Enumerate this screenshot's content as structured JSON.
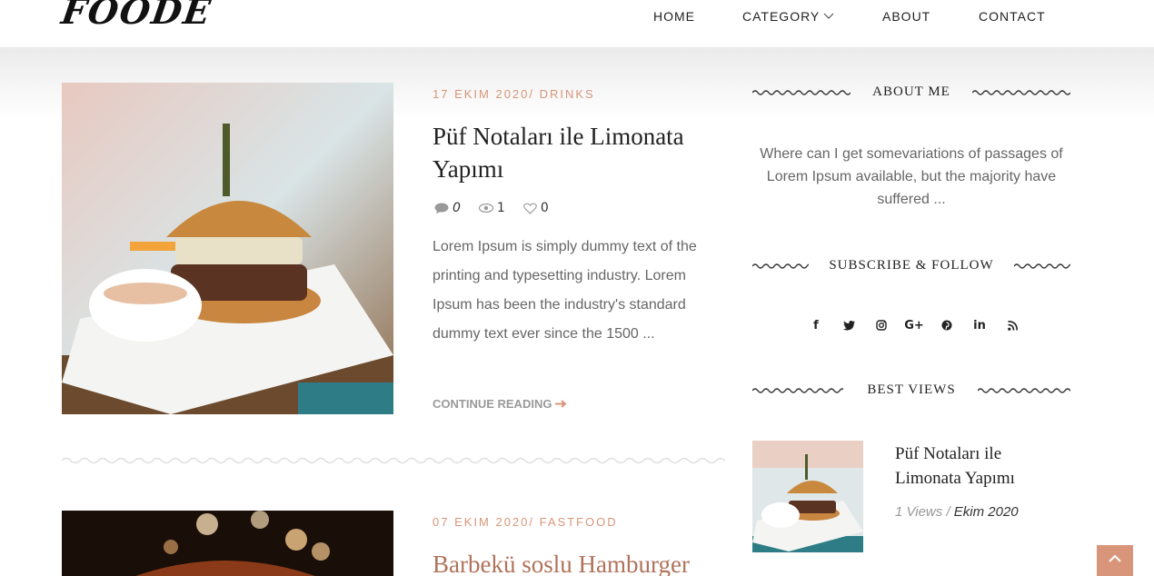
{
  "header": {
    "logo": "FOODE",
    "nav": {
      "home": "HOME",
      "category": "CATEGORY",
      "about": "ABOUT",
      "contact": "CONTACT"
    }
  },
  "posts": [
    {
      "meta": "17 EKIM 2020/ DRINKS",
      "title": "Püf Notaları ile Limonata Yapımı",
      "comments": "0",
      "views": "1",
      "likes": "0",
      "excerpt": "Lorem Ipsum is simply dummy text of the printing and typesetting industry. Lorem Ipsum has been the industry's standard dummy text ever since the 1500 ...",
      "continue": "CONTINUE READING"
    },
    {
      "meta": "07 EKIM 2020/ FASTFOOD",
      "title": "Barbekü soslu Hamburger"
    }
  ],
  "sidebar": {
    "about_title": "ABOUT ME",
    "about_text": "Where can I get somevariations of passages of Lorem Ipsum available, but the majority have suffered ...",
    "follow_title": "SUBSCRIBE & FOLLOW",
    "socials": [
      "f",
      "t",
      "ig",
      "G+",
      "p",
      "in",
      "rss"
    ],
    "best_title": "BEST VIEWS",
    "best_item": {
      "title": "Püf Notaları ile Limonata Yapımı",
      "views": "1 Views",
      "separator": "/",
      "date": "Ekim 2020"
    }
  },
  "colors": {
    "accent": "#d9957a",
    "text": "#444444",
    "muted": "#999999"
  }
}
